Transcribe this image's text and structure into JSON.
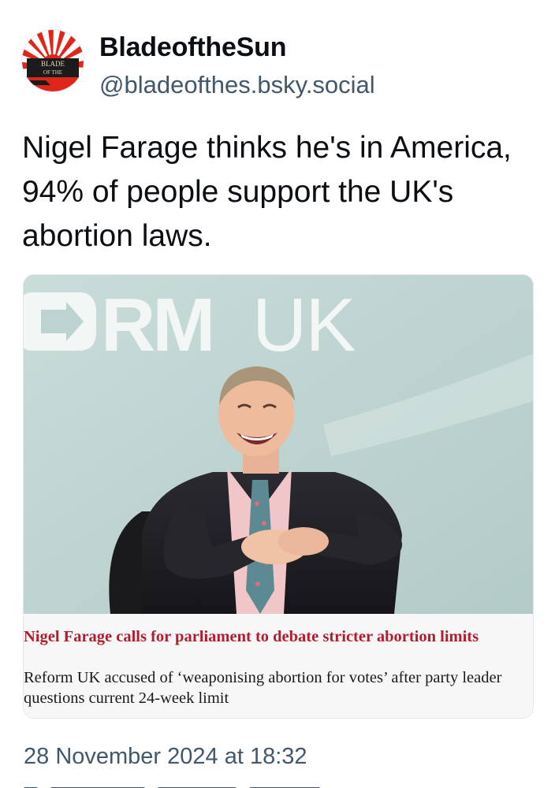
{
  "author": {
    "display_name": "BladeoftheSun",
    "handle": "@bladeofthes.bsky.social",
    "avatar_icon": "rising-sun-avatar-icon",
    "avatar_text": "BLADE OF THE"
  },
  "post": {
    "text": "Nigel Farage thinks he's in America, 94% of people support the UK's abortion laws.",
    "timestamp": "28 November 2024 at 18:32"
  },
  "link_card": {
    "image_backdrop_text": "ORMUK",
    "image_description_icon": "news-photo",
    "title": "Nigel Farage calls for parliament to debate stricter abortion limits",
    "description": "Reform UK accused of ‘weaponising abortion for votes’ after party leader questions current 24-week limit"
  },
  "colors": {
    "text_primary": "#0b0f14",
    "text_secondary": "#42576c",
    "card_title": "#b01e2d",
    "card_caption_bg": "#f7f7f8",
    "image_backdrop": "#bdd3d1"
  }
}
